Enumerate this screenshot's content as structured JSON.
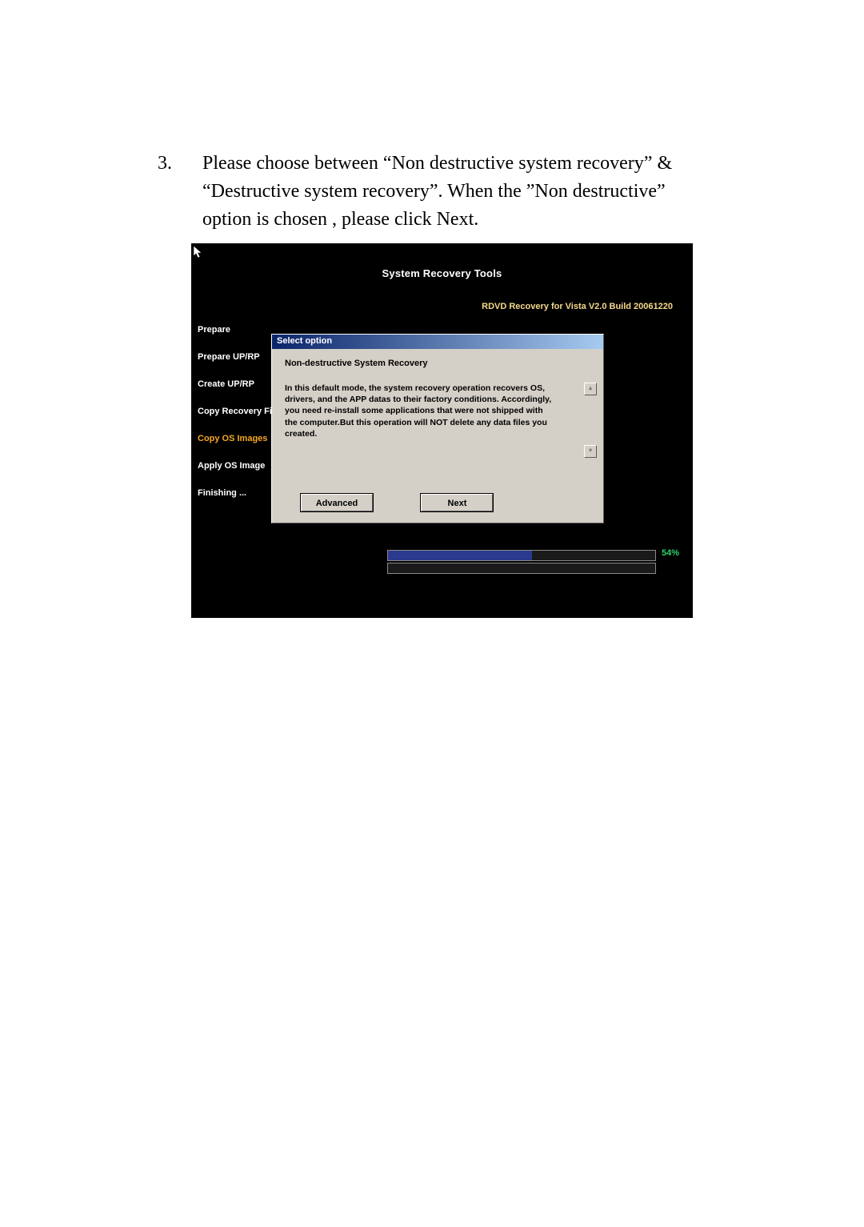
{
  "instruction": {
    "number": "3.",
    "text": "Please choose between “Non destructive system recovery” & “Destructive system recovery”.  When the ”Non destructive” option is chosen , please click Next."
  },
  "screenshot": {
    "title": "System Recovery Tools",
    "version": "RDVD Recovery for Vista V2.0 Build 20061220",
    "sidebar": {
      "items": [
        {
          "label": "Prepare",
          "active": false
        },
        {
          "label": "Prepare UP/RP",
          "active": false
        },
        {
          "label": "Create UP/RP",
          "active": false
        },
        {
          "label": "Copy Recovery File",
          "active": false
        },
        {
          "label": "Copy OS Images",
          "active": true
        },
        {
          "label": "Apply OS Image",
          "active": false
        },
        {
          "label": "Finishing ...",
          "active": false
        }
      ]
    },
    "dialog": {
      "title": "Select option",
      "heading": "Non-destructive System Recovery",
      "description": "In this default mode,  the system recovery operation recovers OS, drivers, and the APP datas to their factory conditions. Accordingly, you need re-install some applications that were not shipped with the computer.But this operation will NOT delete any data files you created.",
      "buttons": {
        "advanced": "Advanced",
        "next": "Next"
      },
      "scroll_up": "▴",
      "scroll_down": "▾"
    },
    "progress": {
      "percent_label": "54%",
      "percent_value": 54,
      "bar1_fill_pct": 54,
      "bar2_fill_pct": 0
    }
  }
}
